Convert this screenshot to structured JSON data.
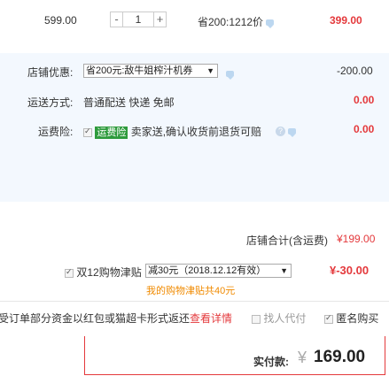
{
  "item": {
    "unit_price": "599.00",
    "qty_minus": "-",
    "quantity": "1",
    "qty_plus": "+",
    "saving_text": "省200:1212价",
    "subtotal": "399.00"
  },
  "shop": {
    "discount_label": "店铺优惠:",
    "discount_selected": "省200元:敌牛姐榨汁机券",
    "discount_amount": "-200.00",
    "shipping_label": "运送方式:",
    "shipping_value": "普通配送 快递 免邮",
    "shipping_amount": "0.00",
    "insurance_label": "运费险:",
    "insurance_badge": "运费险",
    "insurance_text": "卖家送,确认收货前退货可赔",
    "insurance_amount": "0.00",
    "total_label": "店铺合计(含运费)",
    "total_value": "¥199.00"
  },
  "allowance": {
    "label": "双12购物津贴",
    "selected": "减30元（2018.12.12有效）",
    "amount": "¥-30.00",
    "note": "我的购物津贴共40元"
  },
  "bottom": {
    "notice_text": "受订单部分资金以红包或猫超卡形式返还",
    "notice_link": "查看详情",
    "proxy_pay_label": "找人代付",
    "anonymous_label": "匿名购买"
  },
  "pay": {
    "label": "实付款:",
    "currency": "¥",
    "amount": "169.00"
  },
  "colors": {
    "accent_red": "#e4393c",
    "panel_blue": "#f3f8fe",
    "badge_green": "#2e9b3c"
  }
}
